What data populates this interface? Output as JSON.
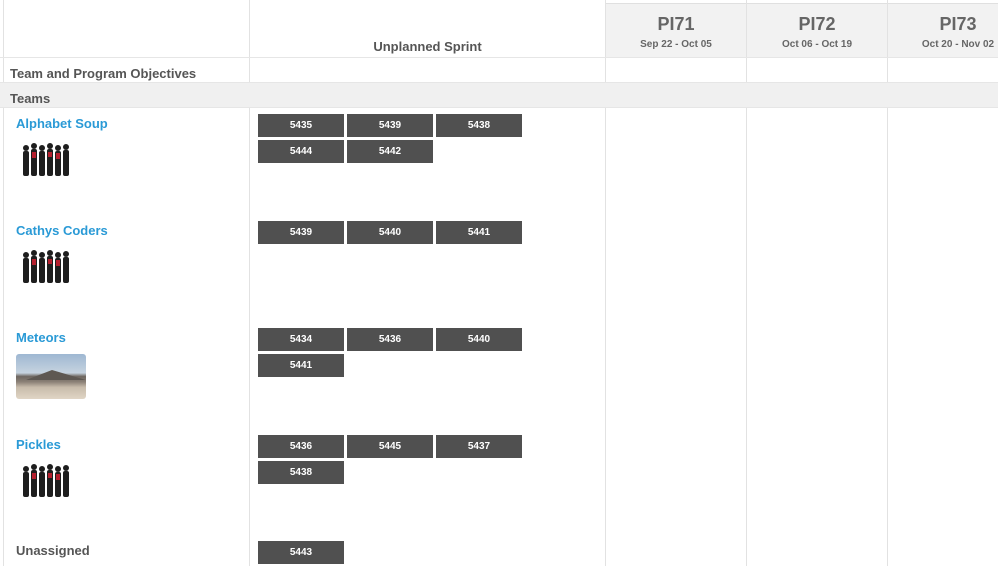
{
  "unplanned": {
    "title": "Unplanned Sprint"
  },
  "pis": [
    {
      "name": "PI71",
      "dates": "Sep 22 - Oct 05"
    },
    {
      "name": "PI72",
      "dates": "Oct 06 - Oct 19"
    },
    {
      "name": "PI73",
      "dates": "Oct 20 - Nov 02"
    }
  ],
  "rows": {
    "objectives": "Team and Program Objectives",
    "teams": "Teams"
  },
  "teams": [
    {
      "name": "Alphabet Soup",
      "avatar": "group-photo-icon",
      "cards": [
        "5435",
        "5439",
        "5438",
        "5444",
        "5442"
      ]
    },
    {
      "name": "Cathys Coders",
      "avatar": "group-photo-icon",
      "cards": [
        "5439",
        "5440",
        "5441"
      ]
    },
    {
      "name": "Meteors",
      "avatar": "landscape-photo-icon",
      "cards": [
        "5434",
        "5436",
        "5440",
        "5441"
      ]
    },
    {
      "name": "Pickles",
      "avatar": "group-photo-icon",
      "cards": [
        "5436",
        "5445",
        "5437",
        "5438"
      ]
    }
  ],
  "unassigned": {
    "label": "Unassigned",
    "cards": [
      "5443"
    ]
  },
  "colors": {
    "team_link": "#2a9ad6",
    "card_bg": "#505050",
    "header_bg": "#f2f2f2"
  }
}
